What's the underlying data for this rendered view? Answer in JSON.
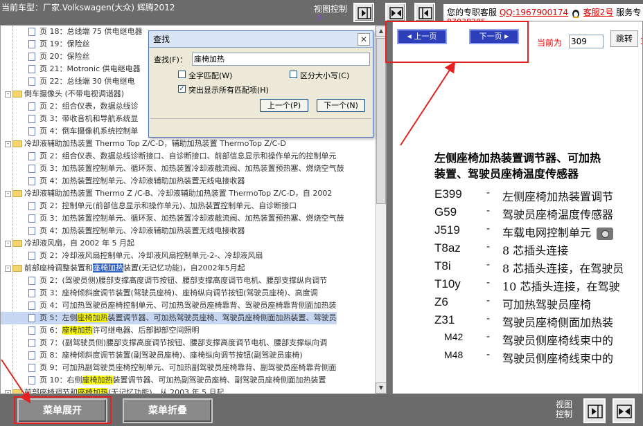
{
  "header": {
    "title": "当前车型：厂家.Volkswagen(大众) 辉腾2012",
    "view_control": "视图控制",
    "view_logo": "ℙ",
    "support_text": "您的专职客服",
    "qq": "QQ:1967900174",
    "kf2": "客服2号",
    "service_suffix": "服务专",
    "support_number": "87038205"
  },
  "tree": {
    "rows": [
      {
        "level": 2,
        "text": "页 18：总线端 75 供电继电器"
      },
      {
        "level": 2,
        "text": "页 19：保险丝"
      },
      {
        "level": 2,
        "text": "页 20：保险丝"
      },
      {
        "level": 2,
        "text": "页 21：Motronic 供电继电器"
      },
      {
        "level": 2,
        "text": "页 22：总线端 30 供电继电"
      },
      {
        "level": 1,
        "text": "倒车摄像头 (不带电视调谐器)"
      },
      {
        "level": 2,
        "text": "页 2：组合仪表，数据总线诊"
      },
      {
        "level": 2,
        "text": "页 3：带收音机和导航系统显"
      },
      {
        "level": 2,
        "text": "页 4：倒车摄像机系统控制单"
      },
      {
        "level": 1,
        "text": "冷却液辅助加热装置 Thermo Top Z/C-D，辅助加热装置 ThermoTop Z/C-D"
      },
      {
        "level": 2,
        "text": "页 2：组合仪表、数据总线诊断接口、自诊断接口、前部信息显示和操作单元的控制单元"
      },
      {
        "level": 2,
        "text": "页 3：加热装置控制单元、循环泵、加热装置冷却液截流阀、加热装置预热塞、燃烧空气鼓"
      },
      {
        "level": 2,
        "text": "页 4：加热装置控制单元、冷却液辅助加热装置无线电接收器"
      },
      {
        "level": 1,
        "text": "冷却液辅助加热装置 Thermo Z /C-B、冷却液辅助加热装置 ThermoTop Z/C-D，自 2002"
      },
      {
        "level": 2,
        "text": "页 2：控制单元(前部信息显示和操作单元)、加热装置控制单元、自诊断接口"
      },
      {
        "level": 2,
        "text": "页 3：加热装置控制单元、循环泵、加热装置冷却液截流阀、加热装置预热塞、燃烧空气鼓"
      },
      {
        "level": 2,
        "text": "页 4：加热装置控制单元、冷却液辅助加热装置无线电接收器"
      },
      {
        "level": 1,
        "text": "冷却液风扇，自 2002 年 5 月起"
      },
      {
        "level": 2,
        "text": "页 2：冷却液风扇控制单元、冷却液风扇控制单元-2-、冷却液风扇"
      },
      {
        "level": 1,
        "pre": "前部座椅调整装置和",
        "sel": "座椅加热",
        "post": "装置(无记忆功能)，自2002年5月起"
      },
      {
        "level": 2,
        "text": "页 2：(驾驶员侧)腰部支撑高度调节按钮、腰部支撑高度调节电机、腰部支撑纵向调节"
      },
      {
        "level": 2,
        "text": "页 3：座椅倾斜度调节装置(驾驶员座椅)、座椅纵向调节按钮(驾驶员座椅)、高度调"
      },
      {
        "level": 2,
        "pre": "页 4：可加热驾驶员座椅控制单元、可加热驾驶员座椅靠背、驾驶员座椅靠背侧面加热装",
        "hl": "",
        "post": ""
      },
      {
        "level": 2,
        "selected": true,
        "pre": "页 5：左侧",
        "hl": "座椅加热",
        "post": "装置调节器、可加热驾驶员座椅、驾驶员座椅侧面加热装置、驾驶员"
      },
      {
        "level": 2,
        "pre": "页 6：",
        "hl": "座椅加热",
        "post": "许可继电器、后部脚部空间照明"
      },
      {
        "level": 2,
        "text": "页 7：(副驾驶员侧)腰部支撑高度调节按钮、腰部支撑高度调节电机、腰部支撑纵向调"
      },
      {
        "level": 2,
        "text": "页 8：座椅倾斜度调节装置(副驾驶员座椅)、座椅纵向调节按钮(副驾驶员座椅)"
      },
      {
        "level": 2,
        "text": "页 9：可加热副驾驶员座椅控制单元、可加热副驾驶员座椅靠背、副驾驶员座椅靠背侧面"
      },
      {
        "level": 2,
        "pre": "页 10：右侧",
        "hl": "座椅加热",
        "post": "装置调节器、可加热副驾驶员座椅、副驾驶员座椅侧面加热装置"
      },
      {
        "level": 1,
        "pre": "前部座椅调节和",
        "hl": "座椅加热",
        "post": "(无记忆功能)，从 2003 年 5 月起"
      }
    ]
  },
  "find_dialog": {
    "title": "查找",
    "find_label": "查找(F)：",
    "find_value": "座椅加热",
    "whole_word": "全字匹配(W)",
    "match_case": "区分大小写(C)",
    "highlight_all": "突出显示所有匹配项(H)",
    "highlight_checked": "✓",
    "prev": "上一个(P)",
    "next": "下一个(N)",
    "close": "✕"
  },
  "viewer": {
    "prev_page": "上一页",
    "next_page": "下一页",
    "current_label": "当前为",
    "current_page": "309",
    "go_button": "跳转",
    "trailing": "3",
    "heading_line1": "左侧座椅加热装置调节器、可加热",
    "heading_line2": "装置、驾驶员座椅温度传感器",
    "legend": [
      {
        "code": "E399",
        "desc": "左侧座椅加热装置调节"
      },
      {
        "code": "G59",
        "desc": "驾驶员座椅温度传感器"
      },
      {
        "code": "J519",
        "desc": "车载电网控制单元"
      },
      {
        "code": "T8az",
        "desc": "8 芯插头连接"
      },
      {
        "code": "T8i",
        "desc": "8 芯插头连接，在驾驶员"
      },
      {
        "code": "T10y",
        "desc": "10 芯插头连接，在驾驶"
      },
      {
        "code": "Z6",
        "desc": "可加热驾驶员座椅"
      },
      {
        "code": "Z31",
        "desc": "驾驶员座椅侧面加热装"
      },
      {
        "code": "M42",
        "desc": "驾驶员侧座椅线束中的"
      },
      {
        "code": "M48",
        "desc": "驾驶员侧座椅线束中的"
      }
    ]
  },
  "bottom": {
    "expand": "菜单展开",
    "collapse": "菜单折叠",
    "view_control": "视图控制"
  },
  "colors": {
    "highlight": "#ffff00",
    "annotation_red": "#e42020",
    "nav_blue": "#2c3fb8"
  }
}
